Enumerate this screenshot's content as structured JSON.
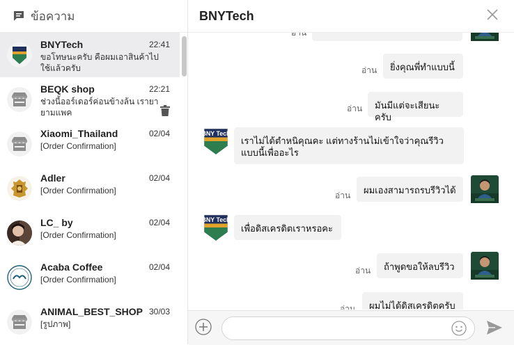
{
  "sidebar": {
    "title": "ข้อความ",
    "conversations": [
      {
        "name": "BNYTech",
        "time": "22:41",
        "preview": "ขอโทษนะครับ คือผมเอาสินค้าไปใช้แล้วครับ",
        "avatar": "bnytech-logo"
      },
      {
        "name": "BEQK shop",
        "time": "22:21",
        "preview": "ช่วงนี้ออร์เดอร์ค่อนข้างล้น เรายายามแพค",
        "avatar": "shop-icon"
      },
      {
        "name": "Xiaomi_Thailand",
        "time": "02/04",
        "preview": "[Order Confirmation]",
        "avatar": "shop-icon"
      },
      {
        "name": "Adler",
        "time": "02/04",
        "preview": "[Order Confirmation]",
        "avatar": "adler-logo"
      },
      {
        "name": "LC_ by",
        "time": "02/04",
        "preview": "[Order Confirmation]",
        "avatar": "photo"
      },
      {
        "name": "Acaba Coffee",
        "time": "02/04",
        "preview": "[Order Confirmation]",
        "avatar": "acaba-logo"
      },
      {
        "name": "ANIMAL_BEST_SHOP",
        "time": "30/03",
        "preview": "[รูปภาพ]",
        "avatar": "shop-icon"
      }
    ]
  },
  "chat": {
    "title": "BNYTech",
    "avatar_text": "BNY Tech",
    "messages": [
      {
        "from": "me",
        "text": "",
        "read": "อ่าน"
      },
      {
        "from": "me",
        "text": "ยิ่งคุณพี่ทำแบบนี้",
        "read": "อ่าน"
      },
      {
        "from": "me",
        "text": "มันมีแต่จะเสียนะครับ",
        "read": "อ่าน"
      },
      {
        "from": "them",
        "text": "เราไม่ได้ตำหนิคุณคะ แต่ทางร้านไม่เข้าใจว่าคุณรีวิวแบบนี้เพื่ออะไร"
      },
      {
        "from": "me",
        "text": "ผมเองสามารถรบรีวิวได้",
        "read": "อ่าน"
      },
      {
        "from": "them",
        "text": "เพื่อดิสเครดิตเราหรอคะ"
      },
      {
        "from": "me",
        "text": "ถ้าพูดขอให้ลบรีวิว",
        "read": "อ่าน"
      },
      {
        "from": "me",
        "text": "ผมไม่ได้ดิสเครดิตครับ",
        "read": "อ่าน"
      }
    ]
  },
  "composer": {
    "placeholder": ""
  },
  "colors": {
    "bny_green": "#2e7d4f",
    "bny_navy": "#20305c",
    "accent": "#ee4d2d"
  }
}
